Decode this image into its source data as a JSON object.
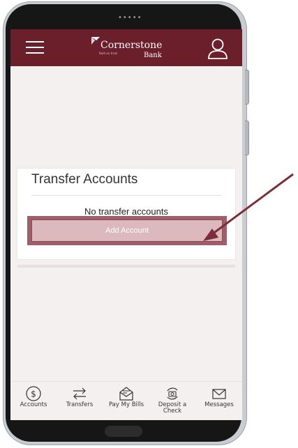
{
  "header": {
    "brand_name": "Cornerstone",
    "brand_sub": "Bank",
    "brand_tagline": "Built on trust"
  },
  "card": {
    "title": "Transfer Accounts",
    "empty_message": "No transfer accounts",
    "add_button_label": "Add Account"
  },
  "tabs": [
    {
      "label": "Accounts",
      "icon": "dollar-circle-icon"
    },
    {
      "label": "Transfers",
      "icon": "transfer-arrows-icon"
    },
    {
      "label": "Pay My Bills",
      "icon": "bill-envelope-icon"
    },
    {
      "label": "Deposit a Check",
      "icon": "camera-deposit-icon"
    },
    {
      "label": "Messages",
      "icon": "mail-icon"
    }
  ],
  "colors": {
    "brand": "#6b1f2a",
    "arrow": "#7b2d3a",
    "button_fill": "#dcb9bf"
  }
}
